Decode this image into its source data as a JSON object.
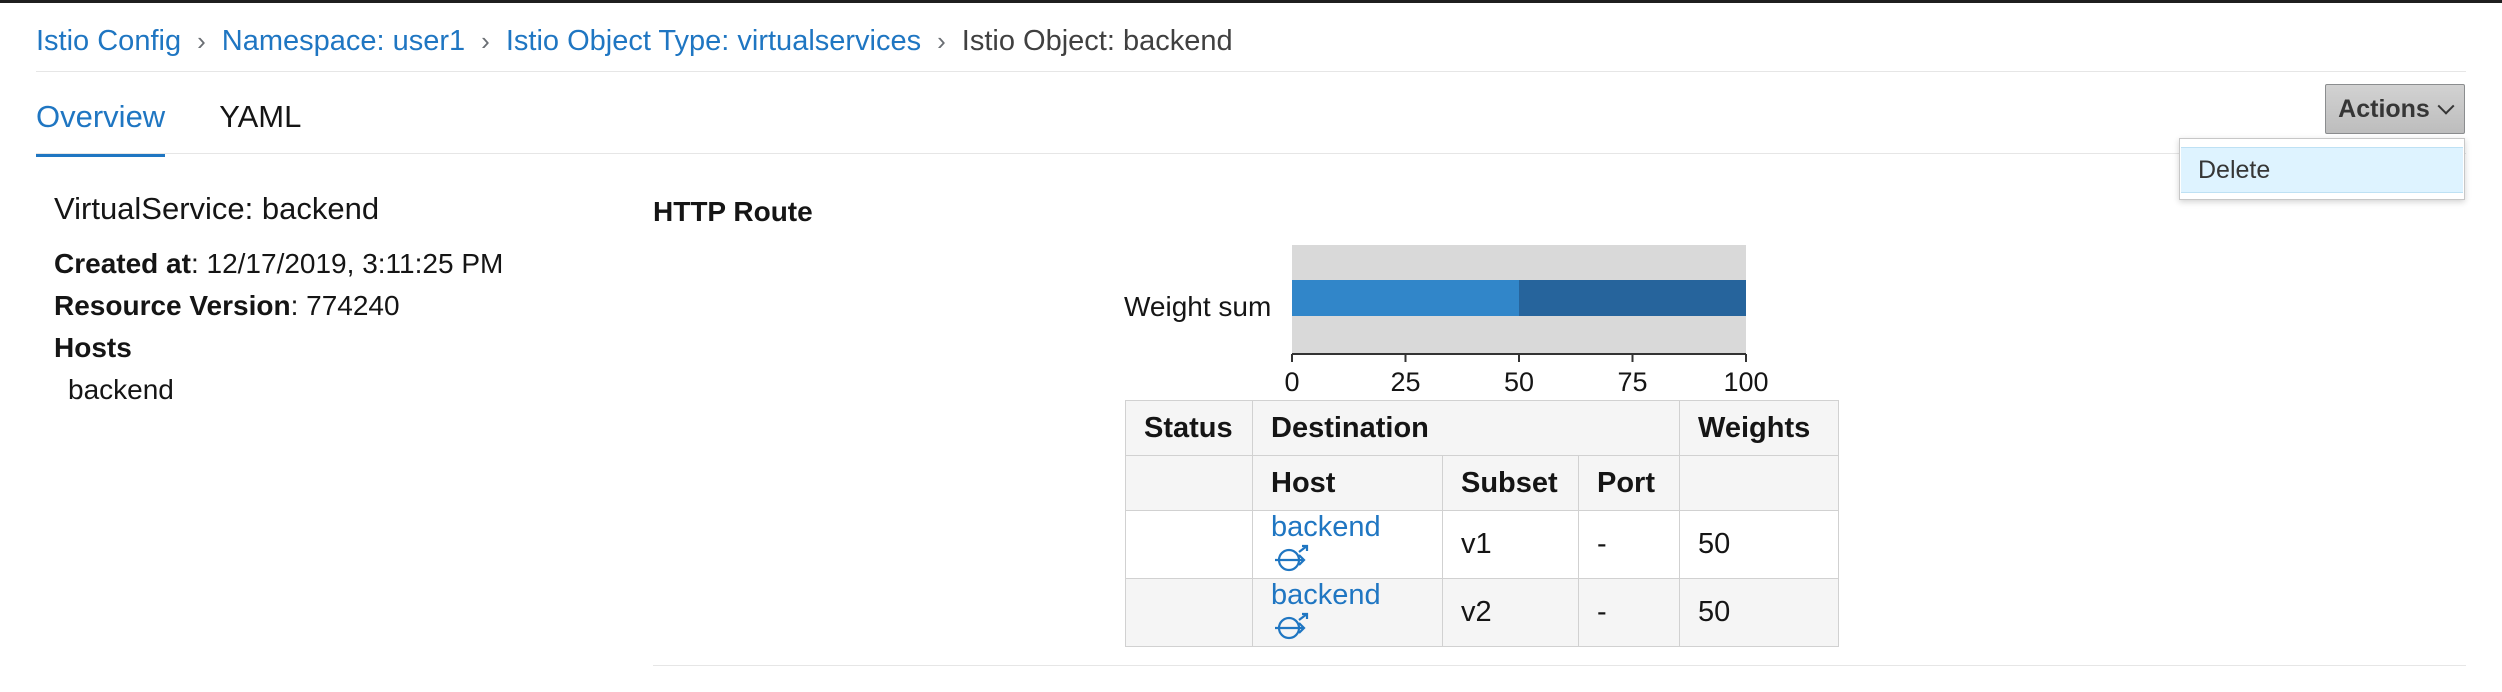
{
  "breadcrumb": {
    "items": [
      "Istio Config",
      "Namespace: user1",
      "Istio Object Type: virtualservices"
    ],
    "current": "Istio Object: backend"
  },
  "tabs": [
    {
      "label": "Overview",
      "active": true
    },
    {
      "label": "YAML",
      "active": false
    }
  ],
  "actions": {
    "label": "Actions",
    "menu": [
      "Delete"
    ]
  },
  "details": {
    "title": "VirtualService: backend",
    "created_label": "Created at",
    "created_value": ": 12/17/2019, 3:11:25 PM",
    "version_label": "Resource Version",
    "version_value": ": 774240",
    "hosts_label": "Hosts",
    "hosts": [
      "backend"
    ]
  },
  "route": {
    "title": "HTTP Route",
    "chart_label": "Weight sum",
    "colors": {
      "v1": "#3186c9",
      "v2": "#26649c",
      "track": "#d9d9d9"
    },
    "table": {
      "headers": {
        "status": "Status",
        "destination": "Destination",
        "weights": "Weights"
      },
      "subheaders": {
        "host": "Host",
        "subset": "Subset",
        "port": "Port"
      },
      "rows": [
        {
          "host": "backend",
          "subset": "v1",
          "port": "-",
          "weight": "50"
        },
        {
          "host": "backend",
          "subset": "v2",
          "port": "-",
          "weight": "50"
        }
      ]
    }
  },
  "chart_data": {
    "type": "bar",
    "categories": [
      "Weight sum"
    ],
    "series": [
      {
        "values": [
          50
        ]
      },
      {
        "values": [
          50
        ]
      }
    ],
    "xlim": [
      0,
      100
    ],
    "ticks": [
      "0",
      "25",
      "50",
      "75",
      "100"
    ],
    "stacked": true,
    "orientation": "horizontal"
  }
}
